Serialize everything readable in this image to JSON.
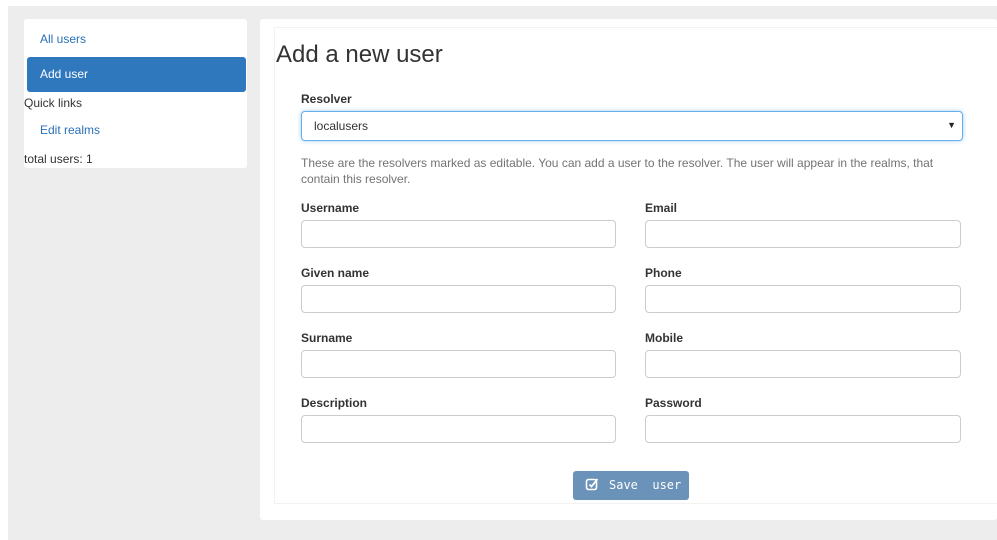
{
  "sidebar": {
    "all_users": "All users",
    "add_user": "Add user",
    "quick_links": "Quick links",
    "edit_realms": "Edit realms",
    "total_users": "total users: 1"
  },
  "form": {
    "title": "Add a new user",
    "resolver_label": "Resolver",
    "resolver_value": "localusers",
    "help_text": "These are the resolvers marked as editable. You can add a user to the resolver. The user will appear in the realms, that contain this resolver.",
    "fields": {
      "username": "Username",
      "email": "Email",
      "given_name": "Given name",
      "phone": "Phone",
      "surname": "Surname",
      "mobile": "Mobile",
      "description": "Description",
      "password": "Password"
    },
    "save_label": "Save  user"
  },
  "colors": {
    "primary": "#2f78bd",
    "link": "#2a6fb7",
    "save_button": "#6b92b8",
    "background": "#ededed"
  }
}
